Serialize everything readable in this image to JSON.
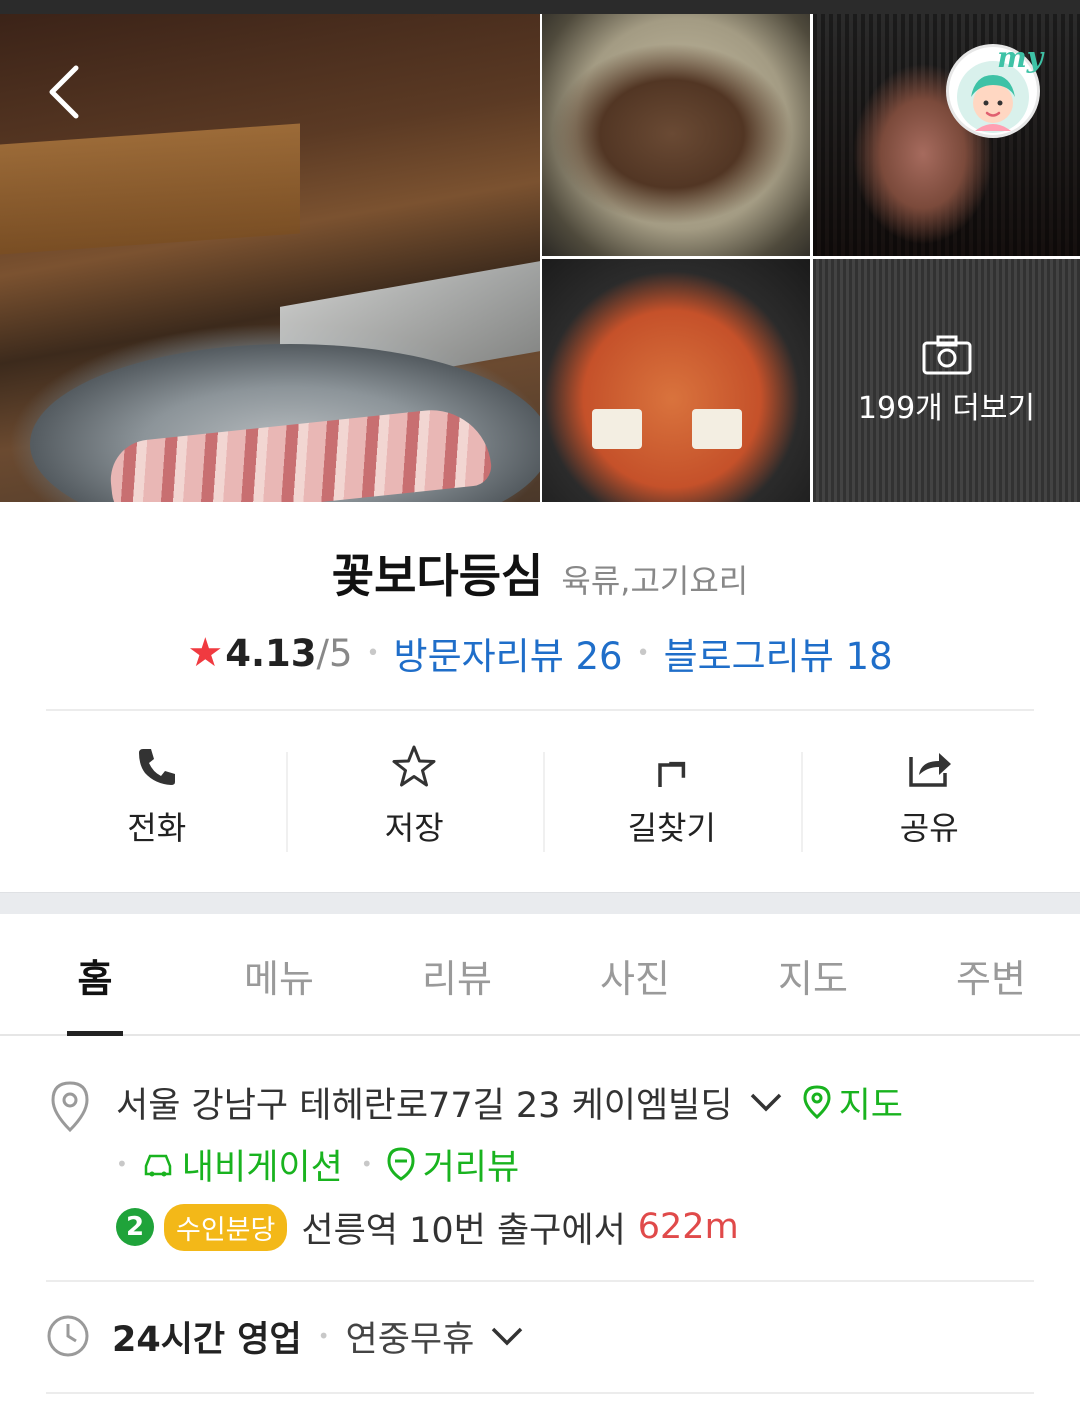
{
  "gallery": {
    "more_photos_label": "199개 더보기",
    "avatar_text": "my"
  },
  "place": {
    "name": "꽃보다등심",
    "category": "육류,고기요리",
    "rating": "4.13",
    "rating_max": "/5",
    "visitor_reviews": "방문자리뷰 26",
    "blog_reviews": "블로그리뷰 18"
  },
  "actions": [
    {
      "label": "전화",
      "icon": "phone-icon"
    },
    {
      "label": "저장",
      "icon": "star-outline-icon"
    },
    {
      "label": "길찾기",
      "icon": "directions-icon"
    },
    {
      "label": "공유",
      "icon": "share-icon"
    }
  ],
  "tabs": [
    {
      "label": "홈",
      "active": true
    },
    {
      "label": "메뉴"
    },
    {
      "label": "리뷰"
    },
    {
      "label": "사진"
    },
    {
      "label": "지도"
    },
    {
      "label": "주변"
    }
  ],
  "info": {
    "address": "서울 강남구 테헤란로77길 23 케이엠빌딩",
    "map_link": "지도",
    "navigation_link": "내비게이션",
    "streetview_link": "거리뷰",
    "subway_line_number": "2",
    "subway_line_name": "수인분당",
    "subway_direction": "선릉역 10번 출구에서",
    "subway_distance": "622m",
    "hours": "24시간 영업",
    "hours_extra": "연중무휴"
  },
  "colors": {
    "accent_blue": "#1f6ec9",
    "link_green": "#19b31f",
    "star_red": "#f03a40",
    "line2_green": "#1fa33a",
    "suin_yellow": "#f3b818",
    "distance_red": "#e04a4a"
  }
}
